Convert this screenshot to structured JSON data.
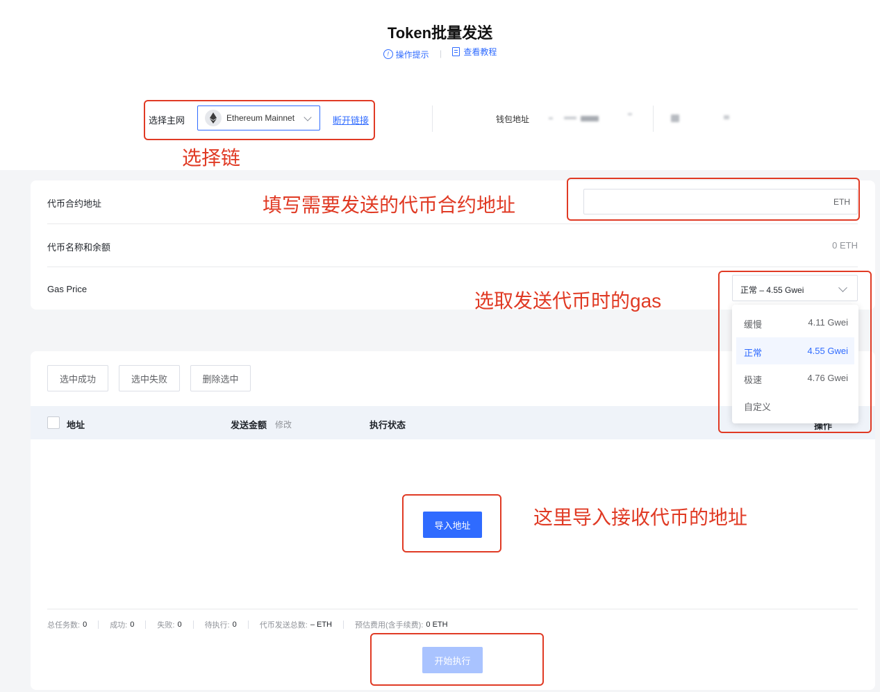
{
  "header": {
    "title": "Token批量发送",
    "tips_link": "操作提示",
    "tutorial_link": "查看教程"
  },
  "network": {
    "label": "选择主网",
    "selected": "Ethereum Mainnet",
    "disconnect": "断开链接",
    "wallet_label": "钱包地址"
  },
  "annotations": {
    "choose_chain": "选择链",
    "fill_contract": "填写需要发送的代币合约地址",
    "choose_gas": "选取发送代币时的gas",
    "import_addresses": "这里导入接收代币的地址"
  },
  "form": {
    "contract_label": "代币合约地址",
    "contract_unit": "ETH",
    "name_balance_label": "代币名称和余额",
    "balance": "0 ETH",
    "gas_label": "Gas Price",
    "gas_selected": "正常 – 4.55 Gwei",
    "gas_options": [
      {
        "name": "缓慢",
        "value": "4.11 Gwei"
      },
      {
        "name": "正常",
        "value": "4.55 Gwei"
      },
      {
        "name": "极速",
        "value": "4.76 Gwei"
      },
      {
        "name": "自定义",
        "value": ""
      }
    ],
    "gas_selected_index": 1
  },
  "toolbar": {
    "select_success": "选中成功",
    "select_failed": "选中失败",
    "delete_selected": "删除选中"
  },
  "table": {
    "col_address": "地址",
    "col_amount": "发送金额",
    "col_amount_edit": "修改",
    "col_status": "执行状态",
    "col_action": "操作"
  },
  "import_button": "导入地址",
  "stats": {
    "total_label": "总任务数:",
    "total": "0",
    "success_label": "成功:",
    "success": "0",
    "failed_label": "失败:",
    "failed": "0",
    "pending_label": "待执行:",
    "pending": "0",
    "amount_label": "代币发送总数:",
    "amount": "– ETH",
    "fee_label": "预估费用(含手续费):",
    "fee": "0 ETH"
  },
  "start_button": "开始执行",
  "colors": {
    "primary": "#2f6bff",
    "annotation_red": "#e03a24",
    "disabled_primary": "#a9c3ff"
  }
}
